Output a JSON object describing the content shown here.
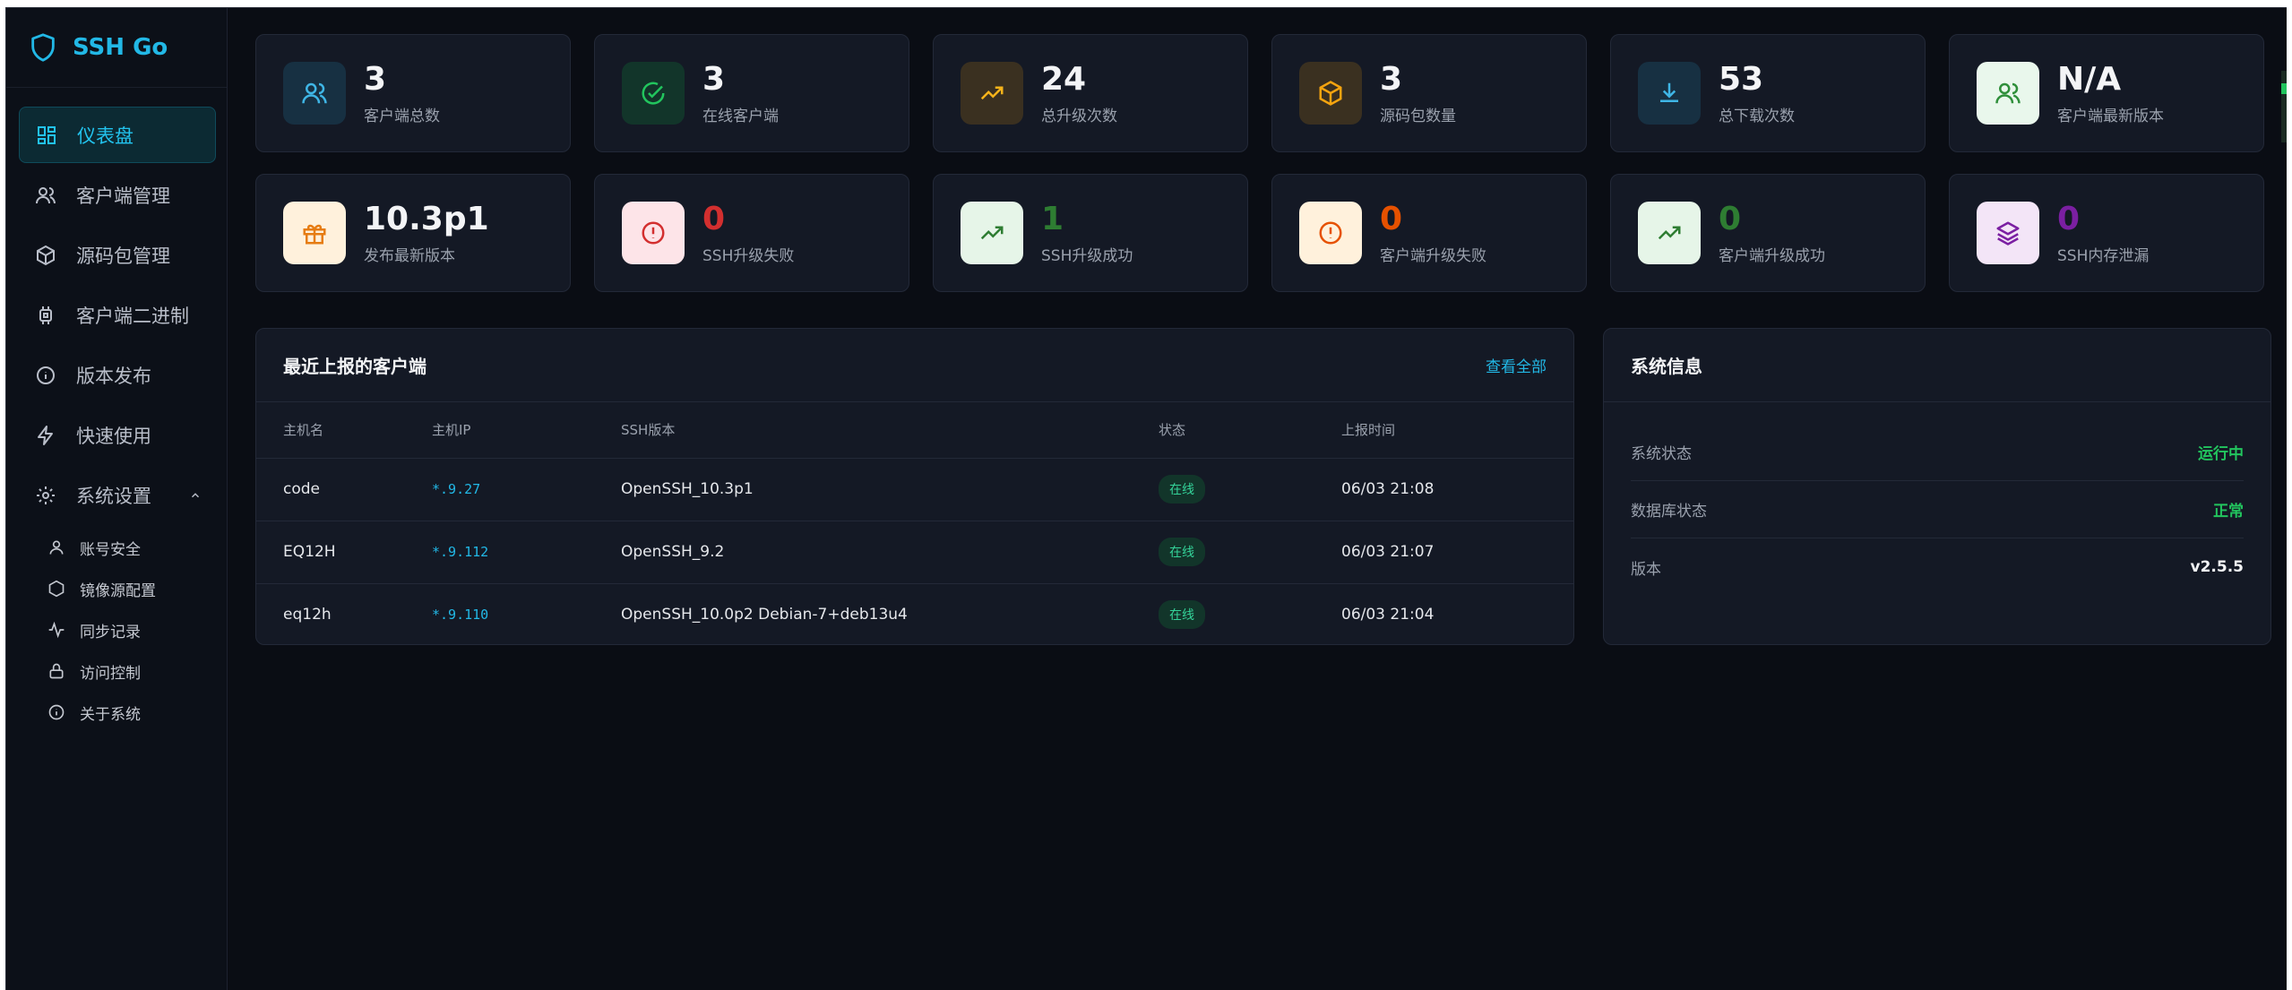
{
  "app": {
    "name": "SSH Go"
  },
  "sidebar": {
    "items": [
      {
        "label": "仪表盘"
      },
      {
        "label": "客户端管理"
      },
      {
        "label": "源码包管理"
      },
      {
        "label": "客户端二进制"
      },
      {
        "label": "版本发布"
      },
      {
        "label": "快速使用"
      },
      {
        "label": "系统设置"
      }
    ],
    "settings_sub": [
      {
        "label": "账号安全"
      },
      {
        "label": "镜像源配置"
      },
      {
        "label": "同步记录"
      },
      {
        "label": "访问控制"
      },
      {
        "label": "关于系统"
      }
    ]
  },
  "stats": [
    {
      "value": "3",
      "label": "客户端总数",
      "icon": "users-icon",
      "bg": "#173042",
      "fg": "#3fb6e6",
      "valcolor": "#f3f4f6"
    },
    {
      "value": "3",
      "label": "在线客户端",
      "icon": "check-circle-icon",
      "bg": "#12352a",
      "fg": "#22c55e",
      "valcolor": "#f3f4f6"
    },
    {
      "value": "24",
      "label": "总升级次数",
      "icon": "trending-up-icon",
      "bg": "#3a3020",
      "fg": "#f5b31a",
      "valcolor": "#f3f4f6"
    },
    {
      "value": "3",
      "label": "源码包数量",
      "icon": "box-icon",
      "bg": "#3a3020",
      "fg": "#f5a40f",
      "valcolor": "#f3f4f6"
    },
    {
      "value": "53",
      "label": "总下载次数",
      "icon": "download-icon",
      "bg": "#173042",
      "fg": "#3fb6e6",
      "valcolor": "#f3f4f6"
    },
    {
      "value": "N/A",
      "label": "客户端最新版本",
      "icon": "users-icon",
      "bg": "#e9f7ec",
      "fg": "#2f8f3a",
      "valcolor": "#f3f4f6"
    },
    {
      "value": "10.3p1",
      "label": "发布最新版本",
      "icon": "gift-icon",
      "bg": "#fff1dc",
      "fg": "#e67c12",
      "valcolor": "#f3f4f6"
    },
    {
      "value": "0",
      "label": "SSH升级失败",
      "icon": "alert-circle-icon",
      "bg": "#fde4e8",
      "fg": "#d32f2f",
      "valcolor": "#d32f2f"
    },
    {
      "value": "1",
      "label": "SSH升级成功",
      "icon": "trending-up-icon",
      "bg": "#e6f5e8",
      "fg": "#2e7d32",
      "valcolor": "#2e7d32"
    },
    {
      "value": "0",
      "label": "客户端升级失败",
      "icon": "alert-circle-icon",
      "bg": "#fff1dc",
      "fg": "#e65100",
      "valcolor": "#e65100"
    },
    {
      "value": "0",
      "label": "客户端升级成功",
      "icon": "trending-up-icon",
      "bg": "#e6f5e8",
      "fg": "#2e7d32",
      "valcolor": "#2e7d32"
    },
    {
      "value": "0",
      "label": "SSH内存泄漏",
      "icon": "layers-icon",
      "bg": "#f3e5f7",
      "fg": "#7b1fa2",
      "valcolor": "#7b1fa2"
    }
  ],
  "clients": {
    "title": "最近上报的客户端",
    "view_all": "查看全部",
    "columns": [
      "主机名",
      "主机IP",
      "SSH版本",
      "状态",
      "上报时间"
    ],
    "rows": [
      {
        "host": "code",
        "ip": "*.9.27",
        "ssh": "OpenSSH_10.3p1",
        "status": "在线",
        "time": "06/03 21:08"
      },
      {
        "host": "EQ12H",
        "ip": "*.9.112",
        "ssh": "OpenSSH_9.2",
        "status": "在线",
        "time": "06/03 21:07"
      },
      {
        "host": "eq12h",
        "ip": "*.9.110",
        "ssh": "OpenSSH_10.0p2 Debian-7+deb13u4",
        "status": "在线",
        "time": "06/03 21:04"
      }
    ]
  },
  "sysinfo": {
    "title": "系统信息",
    "rows": [
      {
        "k": "系统状态",
        "v": "运行中",
        "color": "#22c55e"
      },
      {
        "k": "数据库状态",
        "v": "正常",
        "color": "#22c55e"
      },
      {
        "k": "版本",
        "v": "v2.5.5",
        "color": "#f3f4f6"
      }
    ]
  }
}
